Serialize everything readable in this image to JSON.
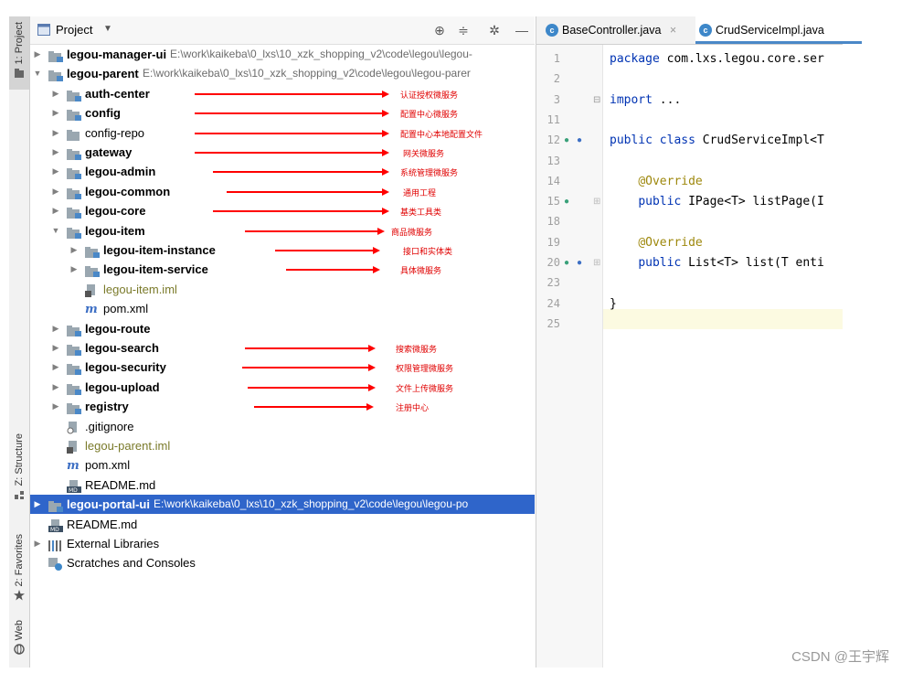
{
  "toolstrip": {
    "project_tab": "1: Project",
    "structure_tab": "Z: Structure",
    "favorites_tab": "2: Favorites",
    "web_tab": "Web"
  },
  "project_panel": {
    "title": "Project",
    "tree": [
      {
        "label": "legou-manager-ui",
        "path": "E:\\work\\kaikeba\\0_lxs\\10_xzk_shopping_v2\\code\\legou\\legou-",
        "bold": true,
        "arrow": "collapsed",
        "icon": "module-folder-icon",
        "indent": 0
      },
      {
        "label": "legou-parent",
        "path": "E:\\work\\kaikeba\\0_lxs\\10_xzk_shopping_v2\\code\\legou\\legou-parer",
        "bold": true,
        "arrow": "expanded",
        "icon": "module-folder-icon",
        "indent": 0
      },
      {
        "label": "auth-center",
        "bold": true,
        "arrow": "collapsed",
        "icon": "module-folder-icon",
        "indent": 1,
        "note": "认证授权微服务"
      },
      {
        "label": "config",
        "bold": true,
        "arrow": "collapsed",
        "icon": "module-folder-icon",
        "indent": 1,
        "note": "配置中心微服务"
      },
      {
        "label": "config-repo",
        "bold": false,
        "arrow": "collapsed",
        "icon": "folder-icon",
        "indent": 1,
        "note": "配置中心本地配置文件"
      },
      {
        "label": "gateway",
        "bold": true,
        "arrow": "collapsed",
        "icon": "module-folder-icon",
        "indent": 1,
        "note": "网关微服务"
      },
      {
        "label": "legou-admin",
        "bold": true,
        "arrow": "collapsed",
        "icon": "module-folder-icon",
        "indent": 1,
        "note": "系统管理微服务"
      },
      {
        "label": "legou-common",
        "bold": true,
        "arrow": "collapsed",
        "icon": "module-folder-icon",
        "indent": 1,
        "note": "通用工程"
      },
      {
        "label": "legou-core",
        "bold": true,
        "arrow": "collapsed",
        "icon": "module-folder-icon",
        "indent": 1,
        "note": "基类工具类"
      },
      {
        "label": "legou-item",
        "bold": true,
        "arrow": "expanded",
        "icon": "module-folder-icon",
        "indent": 1,
        "note": "商品微服务"
      },
      {
        "label": "legou-item-instance",
        "bold": true,
        "arrow": "collapsed",
        "icon": "module-folder-icon",
        "indent": 2,
        "note": "接口和实体类"
      },
      {
        "label": "legou-item-service",
        "bold": true,
        "arrow": "collapsed",
        "icon": "module-folder-icon",
        "indent": 2,
        "note": "具体微服务"
      },
      {
        "label": "legou-item.iml",
        "bold": false,
        "arrow": "none",
        "icon": "iml-file-icon",
        "indent": 2,
        "iml": true
      },
      {
        "label": "pom.xml",
        "bold": false,
        "arrow": "none",
        "icon": "maven-icon",
        "indent": 2
      },
      {
        "label": "legou-route",
        "bold": true,
        "arrow": "collapsed",
        "icon": "module-folder-icon",
        "indent": 1
      },
      {
        "label": "legou-search",
        "bold": true,
        "arrow": "collapsed",
        "icon": "module-folder-icon",
        "indent": 1,
        "note": "搜索微服务"
      },
      {
        "label": "legou-security",
        "bold": true,
        "arrow": "collapsed",
        "icon": "module-folder-icon",
        "indent": 1,
        "note": "权限管理微服务"
      },
      {
        "label": "legou-upload",
        "bold": true,
        "arrow": "collapsed",
        "icon": "module-folder-icon",
        "indent": 1,
        "note": "文件上传微服务"
      },
      {
        "label": "registry",
        "bold": true,
        "arrow": "collapsed",
        "icon": "module-folder-icon",
        "indent": 1,
        "note": "注册中心"
      },
      {
        "label": ".gitignore",
        "bold": false,
        "arrow": "none",
        "icon": "gitignore-icon",
        "indent": 1
      },
      {
        "label": "legou-parent.iml",
        "bold": false,
        "arrow": "none",
        "icon": "iml-file-icon",
        "indent": 1,
        "iml": true
      },
      {
        "label": "pom.xml",
        "bold": false,
        "arrow": "none",
        "icon": "maven-icon",
        "indent": 1
      },
      {
        "label": "README.md",
        "bold": false,
        "arrow": "none",
        "icon": "markdown-icon",
        "indent": 1
      },
      {
        "label": "legou-portal-ui",
        "path": "E:\\work\\kaikeba\\0_lxs\\10_xzk_shopping_v2\\code\\legou\\legou-po",
        "bold": true,
        "arrow": "collapsed",
        "icon": "module-folder-icon",
        "indent": 0,
        "selected": true
      },
      {
        "label": "README.md",
        "bold": false,
        "arrow": "none",
        "icon": "markdown-icon",
        "indent": 0
      },
      {
        "label": "External Libraries",
        "bold": false,
        "arrow": "collapsed",
        "icon": "library-icon",
        "indent": 0
      },
      {
        "label": "Scratches and Consoles",
        "bold": false,
        "arrow": "none",
        "icon": "scratches-icon",
        "indent": 0
      }
    ]
  },
  "editor": {
    "tabs": [
      {
        "label": "BaseController.java",
        "active": false,
        "close": "×"
      },
      {
        "label": "CrudServiceImpl.java",
        "active": true
      }
    ],
    "lines": [
      {
        "num": "1",
        "code": "package com.lxs.legou.core.ser"
      },
      {
        "num": "2",
        "code": ""
      },
      {
        "num": "3",
        "code": "import ..."
      },
      {
        "num": "11",
        "code": ""
      },
      {
        "num": "12",
        "code": "public class CrudServiceImpl<T"
      },
      {
        "num": "13",
        "code": ""
      },
      {
        "num": "14",
        "code": "    @Override"
      },
      {
        "num": "15",
        "code": "    public IPage<T> listPage(I"
      },
      {
        "num": "18",
        "code": ""
      },
      {
        "num": "19",
        "code": "    @Override"
      },
      {
        "num": "20",
        "code": "    public List<T> list(T enti"
      },
      {
        "num": "23",
        "code": ""
      },
      {
        "num": "24",
        "code": "}"
      },
      {
        "num": "25",
        "code": ""
      }
    ]
  },
  "watermark": "CSDN @王宇辉",
  "colors": {
    "selection": "#2f65ca",
    "annotation": "#ff0000",
    "keyword": "#0033b3",
    "annotation_code": "#9e880d"
  }
}
